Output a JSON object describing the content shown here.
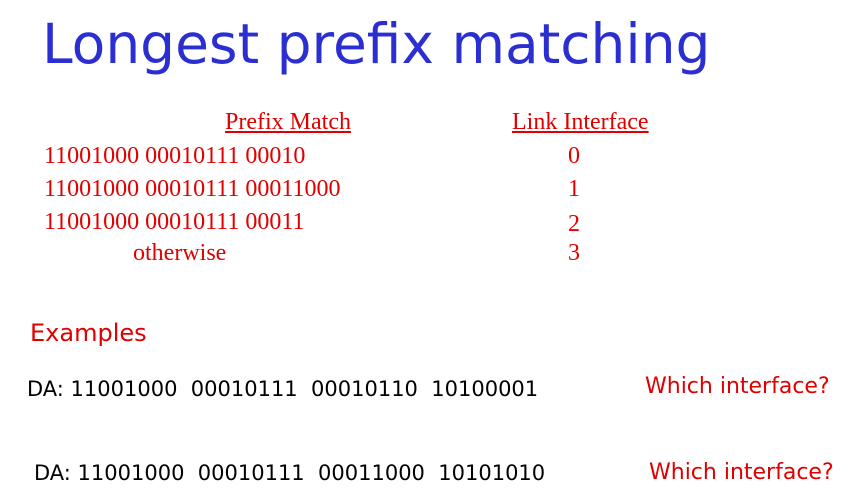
{
  "title": "Longest prefix matching",
  "table": {
    "header_prefix": "Prefix Match",
    "header_link": "Link Interface",
    "rows": [
      {
        "prefix": "11001000 00010111 00010",
        "link": "0"
      },
      {
        "prefix": "11001000 00010111 00011000",
        "link": "1"
      },
      {
        "prefix": "11001000 00010111 00011",
        "link": "2"
      },
      {
        "prefix": "otherwise",
        "link": "3"
      }
    ]
  },
  "examples": {
    "label": "Examples",
    "items": [
      {
        "da": "DA: 11001000  00010111  00010110  10100001",
        "question": "Which interface?"
      },
      {
        "da": "DA: 11001000  00010111  00011000  10101010",
        "question": "Which interface?"
      }
    ]
  }
}
